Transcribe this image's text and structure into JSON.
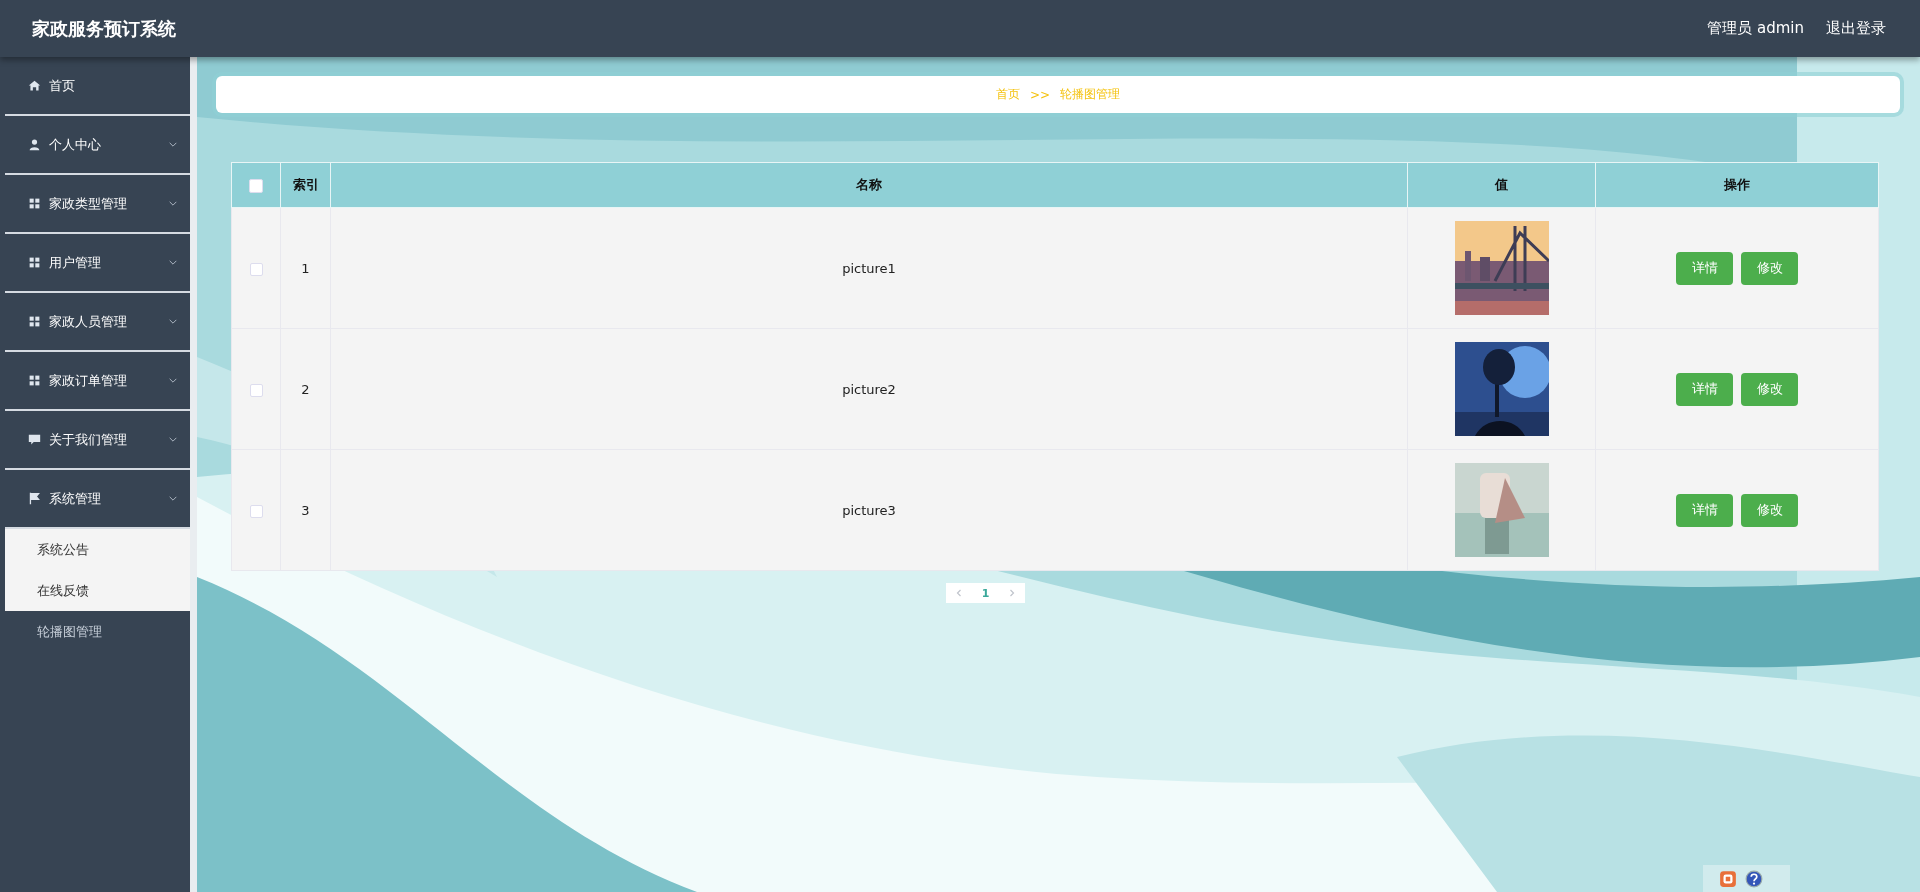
{
  "header": {
    "title": "家政服务预订系统",
    "user": "管理员 admin",
    "logout": "退出登录"
  },
  "sidebar": {
    "items": [
      {
        "label": "首页",
        "kind": "link"
      },
      {
        "label": "个人中心",
        "kind": "menu"
      },
      {
        "label": "家政类型管理",
        "kind": "menu"
      },
      {
        "label": "用户管理",
        "kind": "menu"
      },
      {
        "label": "家政人员管理",
        "kind": "menu"
      },
      {
        "label": "家政订单管理",
        "kind": "menu"
      },
      {
        "label": "关于我们管理",
        "kind": "menu"
      },
      {
        "label": "系统管理",
        "kind": "menu",
        "expanded": true,
        "children": [
          {
            "label": "系统公告",
            "selected": false
          },
          {
            "label": "在线反馈",
            "selected": false
          },
          {
            "label": "轮播图管理",
            "selected": true
          }
        ]
      }
    ]
  },
  "breadcrumb": [
    "首页",
    ">>",
    "轮播图管理"
  ],
  "table": {
    "select_all": {
      "checked": false
    },
    "columns": [
      "索引",
      "名称",
      "值",
      "操作"
    ],
    "rows": [
      {
        "checked": false,
        "index": "1",
        "name": "picture1",
        "actions": [
          "详情",
          "修改"
        ]
      },
      {
        "checked": false,
        "index": "2",
        "name": "picture2",
        "actions": [
          "详情",
          "修改"
        ]
      },
      {
        "checked": false,
        "index": "3",
        "name": "picture3",
        "actions": [
          "详情",
          "修改"
        ]
      }
    ]
  },
  "pagination": {
    "pages": [
      {
        "label": "1",
        "selected": true
      }
    ]
  }
}
